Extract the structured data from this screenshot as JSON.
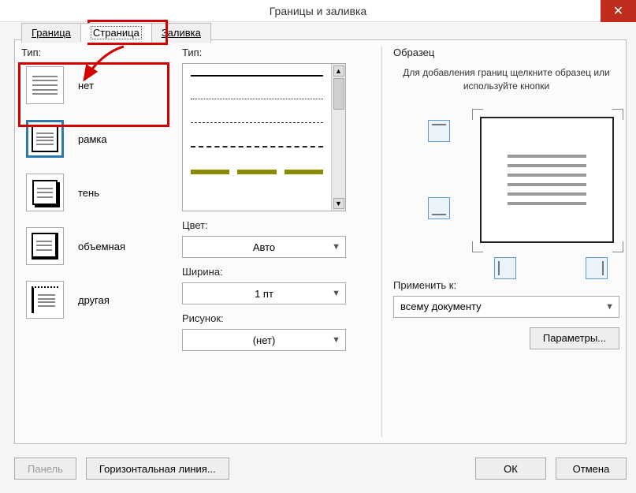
{
  "window": {
    "title": "Границы и заливка"
  },
  "tabs": {
    "border": "Граница",
    "page": "Страница",
    "fill": "Заливка"
  },
  "left": {
    "label": "Тип:",
    "items": {
      "none": "нет",
      "box": "рамка",
      "shadow": "тень",
      "threeD": "объемная",
      "custom": "другая"
    }
  },
  "mid": {
    "styleLabel": "Тип:",
    "colorLabel": "Цвет:",
    "colorValue": "Авто",
    "widthLabel": "Ширина:",
    "widthValue": "1 пт",
    "artLabel": "Рисунок:",
    "artValue": "(нет)"
  },
  "right": {
    "sampleLabel": "Образец",
    "hint": "Для добавления границ щелкните образец или используйте кнопки",
    "applyLabel": "Применить к:",
    "applyValue": "всему документу",
    "optionsBtn": "Параметры..."
  },
  "bottom": {
    "toolbar": "Панель",
    "hline": "Горизонтальная линия...",
    "ok": "ОК",
    "cancel": "Отмена"
  }
}
